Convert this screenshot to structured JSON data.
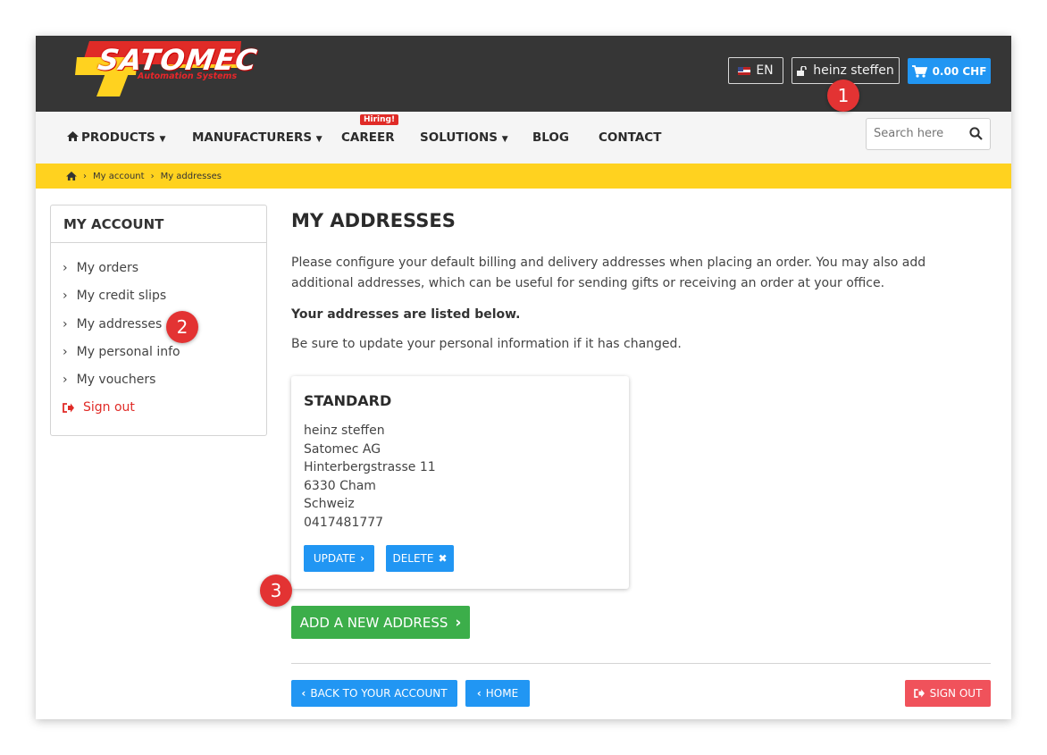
{
  "colors": {
    "header_bg": "#363636",
    "nav_bg": "#f5f5f5",
    "breadcrumb_bg": "#ffd21f",
    "primary_blue": "#2196f3",
    "green": "#3cae4a",
    "danger": "#f0525b",
    "brand_red": "#e02b27",
    "brand_yellow": "#ffd21f",
    "badge_red": "#e33333"
  },
  "header": {
    "logo_text": "SATOMEC",
    "logo_tagline": "Automation Systems",
    "language": "EN",
    "user_name": "heinz steffen",
    "cart_total": "0.00 CHF",
    "icons": {
      "flag": "us-flag-icon",
      "user": "unlock-icon",
      "cart": "cart-icon"
    }
  },
  "nav": {
    "items": [
      {
        "label": "PRODUCTS",
        "icon": "home-icon",
        "dropdown": true
      },
      {
        "label": "MANUFACTURERS",
        "dropdown": true
      },
      {
        "label": "CAREER",
        "badge": "Hiring!"
      },
      {
        "label": "SOLUTIONS",
        "dropdown": true
      },
      {
        "label": "BLOG"
      },
      {
        "label": "CONTACT"
      }
    ],
    "search_placeholder": "Search here"
  },
  "breadcrumb": [
    "My account",
    "My addresses"
  ],
  "sidebar": {
    "title": "MY ACCOUNT",
    "items": [
      "My orders",
      "My credit slips",
      "My addresses",
      "My personal info",
      "My vouchers"
    ],
    "signout": "Sign out"
  },
  "main": {
    "title": "MY ADDRESSES",
    "intro": "Please configure your default billing and delivery addresses when placing an order. You may also add additional addresses, which can be useful for sending gifts or receiving an order at your office.",
    "listed": "Your addresses are listed below.",
    "update_note": "Be sure to update your personal information if it has changed.",
    "address": {
      "title": "STANDARD",
      "lines": [
        "heinz steffen",
        "Satomec AG",
        "Hinterbergstrasse 11",
        "6330 Cham",
        "Schweiz",
        "0417481777"
      ],
      "update": "UPDATE",
      "delete": "DELETE"
    },
    "add_address": "ADD A NEW ADDRESS",
    "back": "BACK TO YOUR ACCOUNT",
    "home": "HOME",
    "signout": "SIGN OUT"
  },
  "annotations": [
    "1",
    "2",
    "3"
  ]
}
